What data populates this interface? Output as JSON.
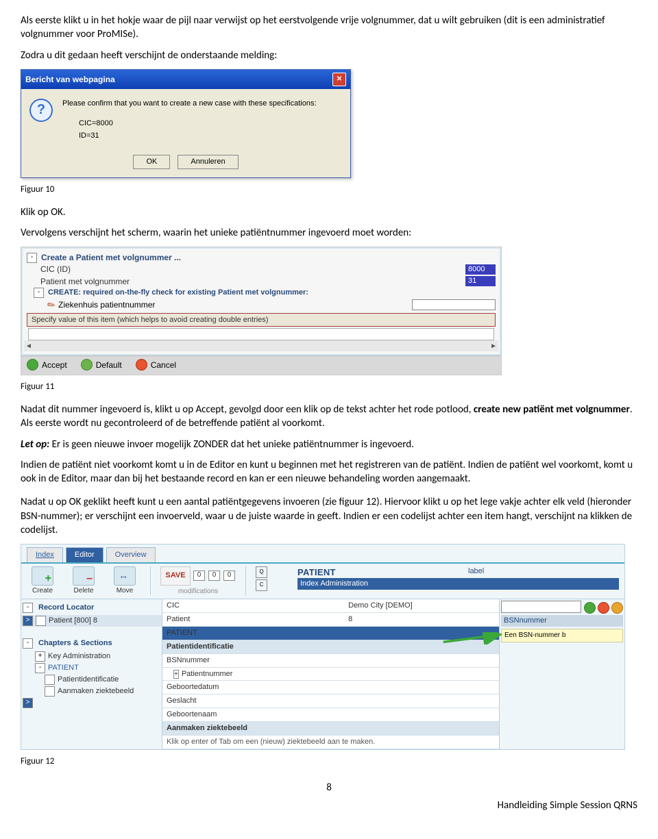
{
  "para1": "Als eerste klikt u in het hokje waar de pijl naar verwijst op het eerstvolgende vrije volgnummer, dat u wilt gebruiken (dit is een administratief volgnummer voor ProMISe).",
  "para2": "Zodra u dit gedaan heeft verschijnt de onderstaande melding:",
  "xp": {
    "title": "Bericht van webpagina",
    "msg1": "Please confirm that you want to create a new case with these specifications:",
    "msg2": "CIC=8000",
    "msg3": "ID=31",
    "ok": "OK",
    "cancel": "Annuleren"
  },
  "cap10": "Figuur 10",
  "para3": "Klik op OK.",
  "para4": "Vervolgens verschijnt het scherm, waarin het unieke patiëntnummer ingevoerd moet worden:",
  "f1": {
    "hdr": "Create a Patient met volgnummer ...",
    "r1l": "CIC (ID)",
    "r1v": "8000",
    "r2l": "Patient met volgnummer",
    "r2v": "31",
    "sub": "CREATE: required on-the-fly check for existing Patient met volgnummer:",
    "r3l": "Ziekenhuis patientnummer",
    "spec": "Specify value of this item (which helps to avoid creating double entries)",
    "accept": "Accept",
    "default": "Default",
    "cancel": "Cancel"
  },
  "cap11": "Figuur 11",
  "para5a": "Nadat dit nummer ingevoerd is, klikt u op Accept, gevolgd door een klik op de tekst achter het rode potlood, ",
  "para5b": "create new patiënt met volgnummer",
  "para5c": ". Als eerste wordt nu gecontroleerd of de betreffende patiënt al voorkomt.",
  "para6a": "Let op:",
  "para6b": " Er is geen nieuwe invoer mogelijk ZONDER dat het unieke patiëntnummer is ingevoerd.",
  "para7": "Indien de patiënt niet voorkomt komt u in de Editor en kunt u beginnen met het registreren van de patiënt. Indien de patiënt wel voorkomt, komt u ook in de Editor, maar dan bij het bestaande record en kan er een nieuwe behandeling worden aangemaakt.",
  "para8": "Nadat u op OK geklikt heeft kunt u een aantal patiëntgegevens invoeren (zie figuur 12). Hiervoor klikt u op het lege vakje achter elk veld (hieronder BSN-nummer); er verschijnt een invoerveld, waar u de juiste waarde in geeft. Indien er een codelijst achter een item hangt, verschijnt na klikken de codelijst.",
  "f2": {
    "tabs": {
      "index": "Index",
      "editor": "Editor",
      "overview": "Overview"
    },
    "tbar": {
      "create": "Create",
      "delete": "Delete",
      "move": "Move",
      "save": "SAVE",
      "mods": "modifications",
      "patient": "PATIENT",
      "idxadmin": "Index Administration",
      "label": "label"
    },
    "left": {
      "rlhead": "Record Locator",
      "rl1": "Patient [800] 8",
      "cshead": "Chapters & Sections",
      "cs1": "Key Administration",
      "cs2": "PATIENT",
      "cs3": "Patientidentificatie",
      "cs4": "Aanmaken ziektebeeld"
    },
    "center": {
      "cic": "CIC",
      "cicval": "Demo City [DEMO]",
      "pat": "Patient",
      "patval": "8",
      "patrow": "PATIENT",
      "pid": "Patientidentificatie",
      "bsn": "BSNnummer",
      "pnr": "Patientnummer",
      "gebd": "Geboortedatum",
      "gesl": "Geslacht",
      "gebn": "Geboortenaam",
      "aanz": "Aanmaken ziektebeeld",
      "klik": "Klik op enter of Tab om een (nieuw) ziektebeeld aan te maken."
    },
    "right": {
      "bsn": "BSNnummer",
      "tip": "Een BSN-nummer b"
    }
  },
  "cap12": "Figuur 12",
  "page": "8",
  "footer": "Handleiding Simple Session QRNS"
}
